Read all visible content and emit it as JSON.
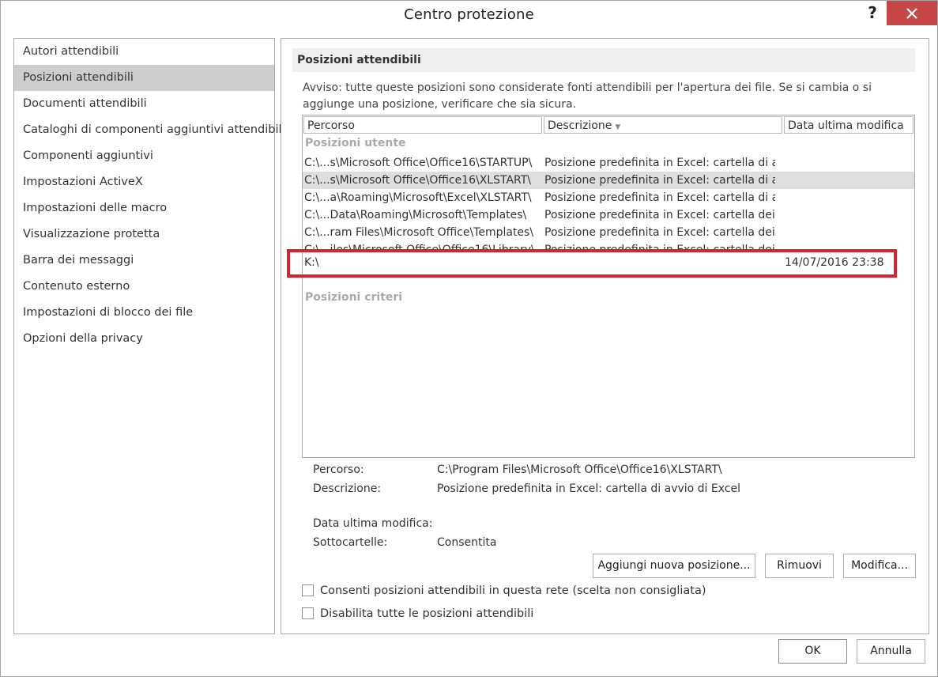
{
  "window": {
    "title": "Centro protezione",
    "help_label": "?"
  },
  "sidebar": {
    "items": [
      {
        "label": "Autori attendibili"
      },
      {
        "label": "Posizioni attendibili",
        "selected": true
      },
      {
        "label": "Documenti attendibili"
      },
      {
        "label": "Cataloghi di componenti aggiuntivi attendibili"
      },
      {
        "label": "Componenti aggiuntivi"
      },
      {
        "label": "Impostazioni ActiveX"
      },
      {
        "label": "Impostazioni delle macro"
      },
      {
        "label": "Visualizzazione protetta"
      },
      {
        "label": "Barra dei messaggi"
      },
      {
        "label": "Contenuto esterno"
      },
      {
        "label": "Impostazioni di blocco dei file"
      },
      {
        "label": "Opzioni della privacy"
      }
    ]
  },
  "main": {
    "section_title": "Posizioni attendibili",
    "warning": "Avviso: tutte queste posizioni sono considerate fonti attendibili per l'apertura dei file. Se si cambia o si aggiunge una posizione, verificare che sia sicura.",
    "columns": [
      "Percorso",
      "Descrizione",
      "Data ultima modifica"
    ],
    "group_user": "Posizioni utente",
    "group_policy": "Posizioni criteri",
    "rows": [
      {
        "path": "C:\\...s\\Microsoft Office\\Office16\\STARTUP\\",
        "description": "Posizione predefinita in Excel: cartella di a...",
        "date": ""
      },
      {
        "path": "C:\\...s\\Microsoft Office\\Office16\\XLSTART\\",
        "description": "Posizione predefinita in Excel: cartella di a...",
        "date": "",
        "selected": true
      },
      {
        "path": "C:\\...a\\Roaming\\Microsoft\\Excel\\XLSTART\\",
        "description": "Posizione predefinita in Excel: cartella di a...",
        "date": ""
      },
      {
        "path": "C:\\...Data\\Roaming\\Microsoft\\Templates\\",
        "description": "Posizione predefinita in Excel: cartella dei ...",
        "date": ""
      },
      {
        "path": "C:\\...ram Files\\Microsoft Office\\Templates\\",
        "description": "Posizione predefinita in Excel: cartella dei ...",
        "date": ""
      },
      {
        "path": "C:\\...iles\\Microsoft Office\\Office16\\Library\\",
        "description": "Posizione predefinita in Excel: cartella dei ...",
        "date": ""
      },
      {
        "path": "K:\\",
        "description": "",
        "date": "14/07/2016 23:38"
      }
    ],
    "details": {
      "path_label": "Percorso:",
      "path_value": "C:\\Program Files\\Microsoft Office\\Office16\\XLSTART\\",
      "description_label": "Descrizione:",
      "description_value": "Posizione predefinita in Excel: cartella di avvio di Excel",
      "date_label": "Data ultima modifica:",
      "date_value": "",
      "subfolders_label": "Sottocartelle:",
      "subfolders_value": "Consentita"
    },
    "buttons": {
      "add": "Aggiungi nuova posizione...",
      "remove": "Rimuovi",
      "modify": "Modifica..."
    },
    "checkboxes": {
      "network": "Consenti posizioni attendibili in questa rete (scelta non consigliata)",
      "disable_all": "Disabilita tutte le posizioni attendibili"
    }
  },
  "footer": {
    "ok": "OK",
    "cancel": "Annulla"
  },
  "colors": {
    "close_button": "#c74646",
    "selection": "#cdcdcd",
    "highlight": "#d9232e"
  }
}
